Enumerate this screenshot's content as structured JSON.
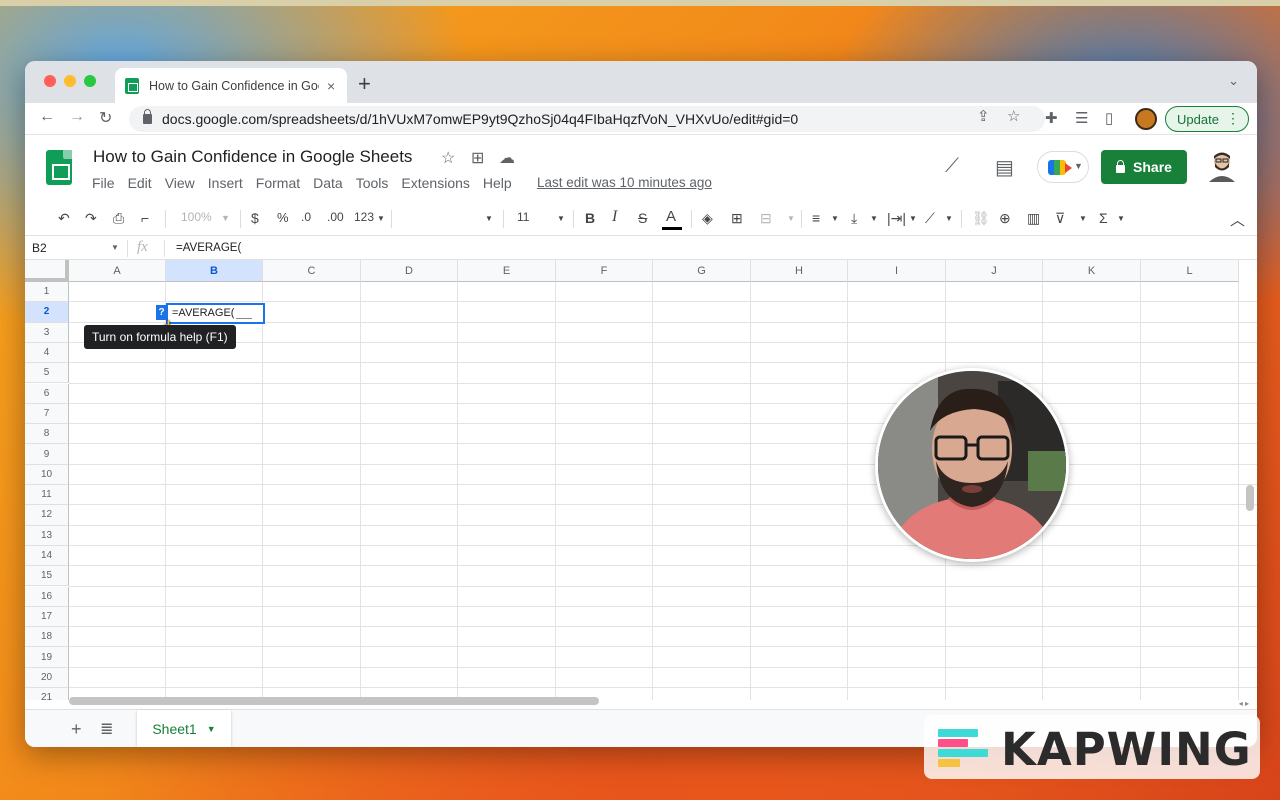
{
  "browser": {
    "tab_title": "How to Gain Confidence in Goo",
    "tab_close": "×",
    "new_tab": "+",
    "url": "docs.google.com/spreadsheets/d/1hVUxM7omwEP9yt9QzhoSj04q4FIbaHqzfVoN_VHXvUo/edit#gid=0",
    "update_label": "Update",
    "icons": [
      "back-icon",
      "forward-icon",
      "reload-icon",
      "lock-icon",
      "share-page-icon",
      "star-icon",
      "extensions-icon",
      "reading-list-icon",
      "side-panel-icon"
    ]
  },
  "sheets": {
    "doc_title": "How to Gain Confidence in Google Sheets",
    "menu": [
      "File",
      "Edit",
      "View",
      "Insert",
      "Format",
      "Data",
      "Tools",
      "Extensions",
      "Help"
    ],
    "last_edit": "Last edit was 10 minutes ago",
    "share_label": "Share"
  },
  "toolbar": {
    "zoom": "100%",
    "currency": "$",
    "percent": "%",
    "dec_decrease": ".0",
    "dec_increase": ".00",
    "number_format": "123",
    "font_size": "11",
    "bold": "B",
    "italic": "I",
    "strike": "S",
    "text_color": "A"
  },
  "formula_bar": {
    "name_box": "B2",
    "fx": "fx",
    "formula": "=AVERAGE("
  },
  "grid": {
    "columns": [
      "A",
      "B",
      "C",
      "D",
      "E",
      "F",
      "G",
      "H",
      "I",
      "J",
      "K",
      "L"
    ],
    "rows": [
      "1",
      "2",
      "3",
      "4",
      "5",
      "6",
      "7",
      "8",
      "9",
      "10",
      "11",
      "12",
      "13",
      "14",
      "15",
      "16",
      "17",
      "18",
      "19",
      "20",
      "21"
    ],
    "selected_column": "B",
    "selected_row": "2",
    "active_cell_value": "=AVERAGE(",
    "help_badge": "?",
    "tooltip": "Turn on formula help (F1)"
  },
  "sheet_tabs": {
    "active": "Sheet1"
  },
  "watermark": {
    "text": "KAPWING",
    "colors": [
      "#3ddad7",
      "#ff4f8b",
      "#f5c242"
    ]
  }
}
